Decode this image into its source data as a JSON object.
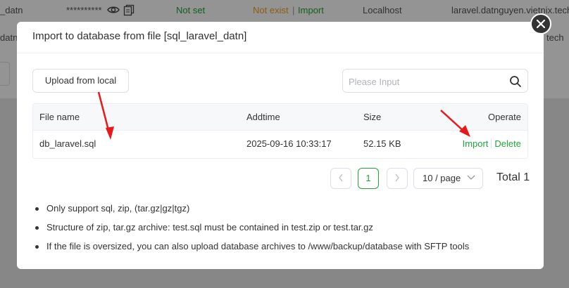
{
  "background": {
    "row1": {
      "name": "_datn",
      "password": "**********",
      "backup_status": "Not set",
      "remote_status": "Not exist",
      "separator": "|",
      "import_link": "Import",
      "location": "Localhost",
      "host": "laravel.datnguyen.vietnix.tech"
    },
    "row2": {
      "name_fragment": "datngu",
      "host_fragment": "tech"
    }
  },
  "dialog": {
    "title": "Import to database from file [sql_laravel_datn]",
    "close_label": "×",
    "upload_label": "Upload from local",
    "search": {
      "placeholder": "Please Input",
      "value": ""
    },
    "table": {
      "columns": [
        "File name",
        "Addtime",
        "Size",
        "Operate"
      ],
      "rows": [
        {
          "file_name": "db_laravel.sql",
          "addtime": "2025-09-16 10:33:17",
          "size": "52.15 KB",
          "import_label": "Import",
          "delete_label": "Delete"
        }
      ]
    },
    "pagination": {
      "current_page": "1",
      "page_size": "10 / page",
      "total": "Total 1"
    },
    "notes": [
      "Only support sql, zip, (tar.gz|gz|tgz)",
      "Structure of zip, tar.gz archive: test.sql must be contained in test.zip or test.tar.gz",
      "If the file is oversized, you can also upload database archives to /www/backup/database with SFTP tools"
    ]
  },
  "colors": {
    "accent": "#20a53a",
    "warning": "#f0a020",
    "annotation_arrow": "#e8191c"
  },
  "icons": [
    "eye-icon",
    "copy-icon",
    "search-icon",
    "close-icon",
    "chevron-left-icon",
    "chevron-right-icon",
    "chevron-down-icon"
  ]
}
